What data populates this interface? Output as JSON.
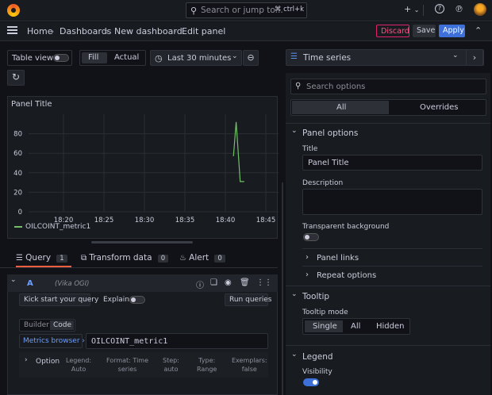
{
  "topbar": {
    "search_placeholder": "Search or jump to...",
    "search_shortcut": "ctrl+k",
    "plus_label": "+",
    "help_icon": "help-icon",
    "rss_icon": "rss-icon"
  },
  "breadcrumb": {
    "home": "Home",
    "dashboards": "Dashboards",
    "new_dashboard": "New dashboard",
    "current": "Edit panel",
    "separator": "›"
  },
  "actions": {
    "discard": "Discard",
    "save": "Save",
    "apply": "Apply"
  },
  "toolbar": {
    "table_view": "Table view",
    "fill": "Fill",
    "actual": "Actual",
    "time_range": "Last 30 minutes"
  },
  "panel": {
    "title": "Panel Title",
    "legend_label": "OILCOINT_metric1"
  },
  "chart_data": {
    "type": "line",
    "title": "Panel Title",
    "x_ticks": [
      "18:20",
      "18:25",
      "18:30",
      "18:35",
      "18:40",
      "18:45"
    ],
    "y_ticks": [
      0,
      20,
      40,
      60,
      80
    ],
    "ylim": [
      0,
      100
    ],
    "grid": true,
    "legend_placement": "bottom-left",
    "series": [
      {
        "name": "OILCOINT_metric1",
        "color": "#73bf69",
        "points": [
          {
            "x": "18:41:00",
            "y": 57
          },
          {
            "x": "18:41:20",
            "y": 92
          },
          {
            "x": "18:41:50",
            "y": 31
          },
          {
            "x": "18:42:20",
            "y": 31
          }
        ]
      }
    ]
  },
  "query_tabs": [
    {
      "label": "Query",
      "count": "1"
    },
    {
      "label": "Transform data",
      "count": "0"
    },
    {
      "label": "Alert",
      "count": "0"
    }
  ],
  "query": {
    "ref": "A",
    "datasource": "(Vika OGI)",
    "kickstart": "Kick start your query",
    "explain": "Explain",
    "run": "Run queries",
    "builder": "Builder",
    "code": "Code",
    "metrics_browser": "Metrics browser",
    "metrics_browser_chevron": "›",
    "expr": "OILCOINT_metric1",
    "options_label": "Option",
    "options": [
      {
        "k": "Legend:",
        "v": "Auto"
      },
      {
        "k": "Format: Time",
        "v": "series"
      },
      {
        "k": "Step:",
        "v": "auto"
      },
      {
        "k": "Type:",
        "v": "Range"
      },
      {
        "k": "Exemplars:",
        "v": "false"
      }
    ]
  },
  "options_pane": {
    "visualization": "Time series",
    "search_placeholder": "Search options",
    "tab_all": "All",
    "tab_overrides": "Overrides",
    "panel_options_header": "Panel options",
    "title_label": "Title",
    "title_value": "Panel Title",
    "description_label": "Description",
    "transparent_label": "Transparent background",
    "panel_links": "Panel links",
    "repeat_options": "Repeat options",
    "tooltip_header": "Tooltip",
    "tooltip_mode_label": "Tooltip mode",
    "tooltip_modes": [
      "Single",
      "All",
      "Hidden"
    ],
    "legend_header": "Legend",
    "visibility_label": "Visibility"
  },
  "colors": {
    "accent": "#3d71d9",
    "discard": "#e0226e",
    "series": "#73bf69",
    "query_tab_underline": "#f55f3e"
  }
}
